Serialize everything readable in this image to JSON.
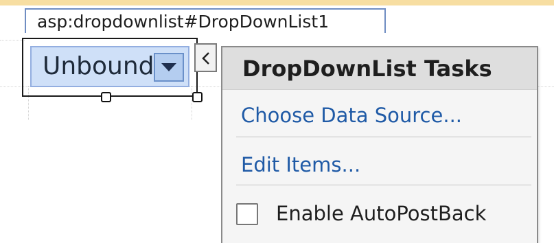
{
  "designer": {
    "control_tag": "asp:dropdownlist#DropDownList1"
  },
  "dropdown": {
    "selected_value": "Unbound",
    "arrow_icon": "triangle-down-icon"
  },
  "smart_tag": {
    "collapse_icon": "chevron-left-icon"
  },
  "tasks_panel": {
    "title": "DropDownList Tasks",
    "items": [
      {
        "label": "Choose Data Source..."
      },
      {
        "label": "Edit Items..."
      }
    ],
    "checkbox": {
      "label": "Enable AutoPostBack",
      "checked": false
    }
  },
  "colors": {
    "accent_band": "#f7dea2",
    "selection_fill": "#cfe0f8",
    "link": "#1f5aa6"
  }
}
